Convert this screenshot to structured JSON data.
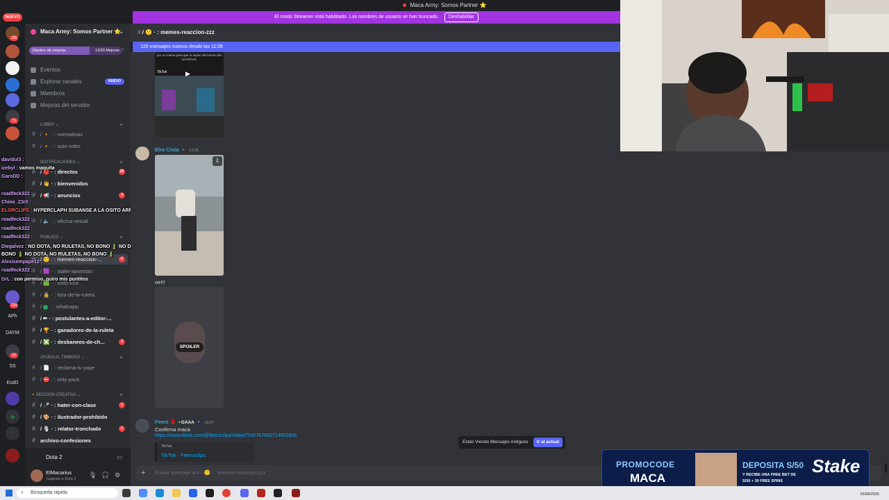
{
  "topbar": {
    "title": "Maca Army: Somos Partner ⭐"
  },
  "nuevo": "NUEVO",
  "banner": {
    "text": "El modo Streamer está habilitado. Los nombres de usuario se han truncado.",
    "button": "Deshabilitar"
  },
  "rail": {
    "badges": [
      "105",
      "71",
      "224",
      "42"
    ],
    "labels": [
      "APh",
      "DAYM",
      "SS",
      "EsdD"
    ]
  },
  "server": {
    "name": "Maca Army: Somos Partner ⭐",
    "goal_label": "Objetivo de mejoras",
    "goal_value": "13/20 Mejoras",
    "goal_fraction": 0.65
  },
  "nav": {
    "events": "Eventos",
    "explore": "Explorar canales",
    "explore_badge": "NUEVO",
    "members": "Miembros",
    "boosts": "Mejoras del servidor"
  },
  "categories": {
    "lobby": "LOBBY",
    "notif": "NOTIFICACIONES",
    "publico": "PÚBLICO",
    "ayuda": "AYUDA AL TIMBERO",
    "creativa": "SECCIÓN CREATIVA"
  },
  "channels": {
    "normativas": "normativas",
    "autoroles": "auto-roles",
    "directos": "directos",
    "directos_count": "29",
    "bienvenidos": "bienvenidos",
    "anuncios": "anuncios",
    "anuncios_count": "3",
    "oficina": "oficina-virtual",
    "memes": "memes-reaccion-...",
    "memes_count": "6",
    "stake": "stake-apuestas",
    "sods": "sods-kick",
    "ruleta": "lista-de-la-ruleta",
    "whatsapp": "whatsapp",
    "postulantes": "postulantes-a-editor-...",
    "ganadores": "ganadores-de-la-ruleta",
    "desbaneos": "desbaneos-de-ch...",
    "desbaneos_count": "3",
    "yape": "reclama-tu-yape",
    "onlypack": "only-pack",
    "hater": "hater-con-clase",
    "hater_count": "1",
    "ilustrador": "ilustrador-prohibido",
    "relator": "relator-tronchado",
    "relator_count": "1",
    "archivo": "archivo-confesiones"
  },
  "voice": "Dota 2",
  "user": {
    "name": "ElMacarius",
    "status": "Jugando a Dota 2"
  },
  "overlay": [
    {
      "user": "davidul3 :",
      "text": ""
    },
    {
      "user": "izebyl :",
      "text": "vamos maquita"
    },
    {
      "user": "GaroDD :",
      "text": ""
    },
    {
      "user": "roadfeck322 :",
      "text": ""
    },
    {
      "user": "Chino_Z3r0 :",
      "text": ""
    },
    {
      "user": "ELORCLIPS :",
      "text": "HYPERCLAPH SUBANSE A LA OSITO ARMY HYPERCLAPH"
    },
    {
      "user": "roadfeck322 :",
      "text": ""
    },
    {
      "user": "roadfeck322 :",
      "text": ""
    },
    {
      "user": "roadfeck322 :",
      "text": ""
    },
    {
      "user": "Diegalvez :",
      "text": "NO DOTA, NO RULETAS, NO BONO 🎍 NO DOTA, NO RULETAS, NO"
    },
    {
      "user": "",
      "text": "BONO 🎍 NO DOTA, NO RULETAS, NO BONO 🎍"
    },
    {
      "user": "Alexisempape12 :",
      "text": ""
    },
    {
      "user": "roadfeck322 :",
      "text": ""
    },
    {
      "user": "GrL :",
      "text": "con permiso, quiro mis puntitos"
    }
  ],
  "chat": {
    "channel": "memes-reaccion-zzz",
    "new_messages": "120 mensajes nuevos desde las 11:26",
    "msg1_user": "Elra Cista",
    "msg1_time": "13:05",
    "caption": "oe!!!",
    "spoiler": "SPOILER",
    "msg2_user": "Feerz",
    "msg2_tag": "GAAA",
    "msg2_time": "13:07",
    "msg2_text": "Confirma maca",
    "link": "https://www.tiktok.com/@feenzclips/video/7542767682714602808",
    "embed_provider": "TikTok",
    "embed_title": "TikTok - Feenzclips",
    "tiktok_label": "TikTok",
    "top_caption": "por un meme para que lo sepan del evento del SACRAVIL",
    "old_notice": "Estás Viendo Mensajes Antiguos",
    "old_button": "Ir al actual",
    "composer": "Enviar mensaje a # / 🙂 · : memes-reaccion-zzz"
  },
  "ad": {
    "promo": "PROMOCODE",
    "code": "MACA",
    "deposit": "DEPOSITA S/50",
    "line1": "Y RECIBE UNA FREE BET DE",
    "line2": "S/50 + 30 FREE SPINS",
    "brand": "Stake"
  },
  "taskbar": {
    "search": "Búsqueda rápida",
    "date": "26/08/2025"
  }
}
